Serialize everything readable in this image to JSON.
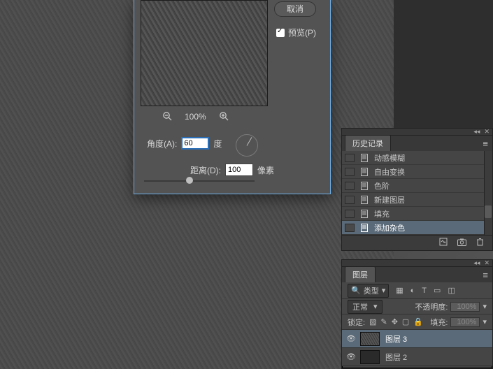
{
  "dialog": {
    "cancel": "取消",
    "preview_label": "预览(P)",
    "zoom_pct": "100%",
    "angle_label": "角度(A):",
    "angle_value": "60",
    "angle_unit": "度",
    "distance_label": "距离(D):",
    "distance_value": "100",
    "distance_unit": "像素"
  },
  "history": {
    "tab": "历史记录",
    "items": [
      {
        "label": "动感模糊"
      },
      {
        "label": "自由变换"
      },
      {
        "label": "色阶"
      },
      {
        "label": "新建图层"
      },
      {
        "label": "填充"
      },
      {
        "label": "添加杂色"
      }
    ]
  },
  "layers": {
    "tab": "图层",
    "kind_label": "类型",
    "blend_mode": "正常",
    "opacity_label": "不透明度:",
    "opacity_value": "100%",
    "lock_label": "锁定:",
    "fill_label": "填充:",
    "fill_value": "100%",
    "items": [
      {
        "name": "图层 3"
      },
      {
        "name": "图层 2"
      }
    ]
  }
}
